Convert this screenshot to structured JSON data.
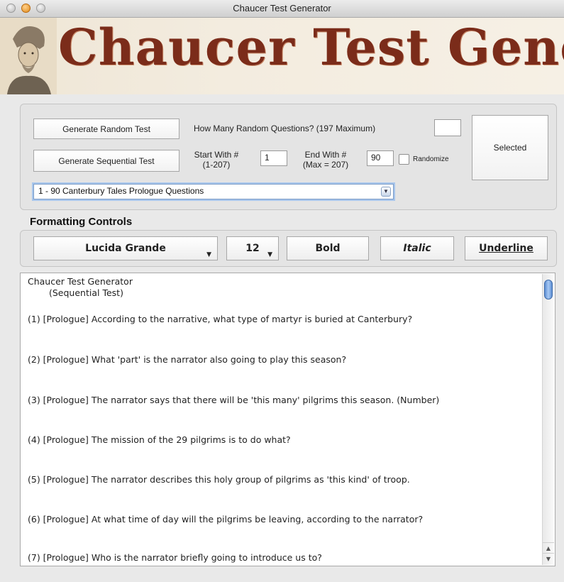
{
  "window": {
    "title": "Chaucer Test Generator"
  },
  "banner": {
    "title": "Chaucer Test Generator"
  },
  "controls": {
    "random_button": "Generate Random Test",
    "how_many_label": "How Many Random Questions? (197 Maximum)",
    "how_many_value": "",
    "sequential_button": "Generate Sequential Test",
    "start_label_1": "Start With #",
    "start_label_2": "(1-207)",
    "start_value": "1",
    "end_label_1": "End With #",
    "end_label_2": "(Max = 207)",
    "end_value": "90",
    "randomize_label": "Randomize",
    "randomize_checked": false,
    "selected_button": "Selected",
    "question_set": "1 - 90 Canterbury Tales Prologue Questions"
  },
  "formatting": {
    "title": "Formatting Controls",
    "font": "Lucida Grande",
    "size": "12",
    "bold": "Bold",
    "italic": "Italic",
    "underline": "Underline"
  },
  "document": {
    "heading": "Chaucer Test Generator",
    "subheading": "(Sequential Test)",
    "questions": [
      "(1)  [Prologue] According to the narrative, what type of martyr is buried at Canterbury?",
      "(2)  [Prologue] What 'part' is the narrator also going to play this season?",
      "(3)  [Prologue] The narrator says that there will be 'this many' pilgrims this season. (Number)",
      "(4)  [Prologue] The mission of the 29 pilgrims is to do what?",
      "(5)  [Prologue] The narrator describes this holy group of pilgrims as 'this kind' of troop.",
      "(6)  [Prologue] At what time of day will the pilgrims be leaving, according to the narrator?",
      "(7)  [Prologue] Who is the narrator briefly going to introduce us to?"
    ]
  },
  "icons": {
    "close": "close-icon",
    "minimize": "minimize-icon",
    "zoom": "zoom-icon",
    "dropdown": "chevron-down-icon",
    "portrait": "chaucer-portrait-icon"
  },
  "colors": {
    "banner_title": "#7b2c1a",
    "accent": "#5d8fd4"
  }
}
